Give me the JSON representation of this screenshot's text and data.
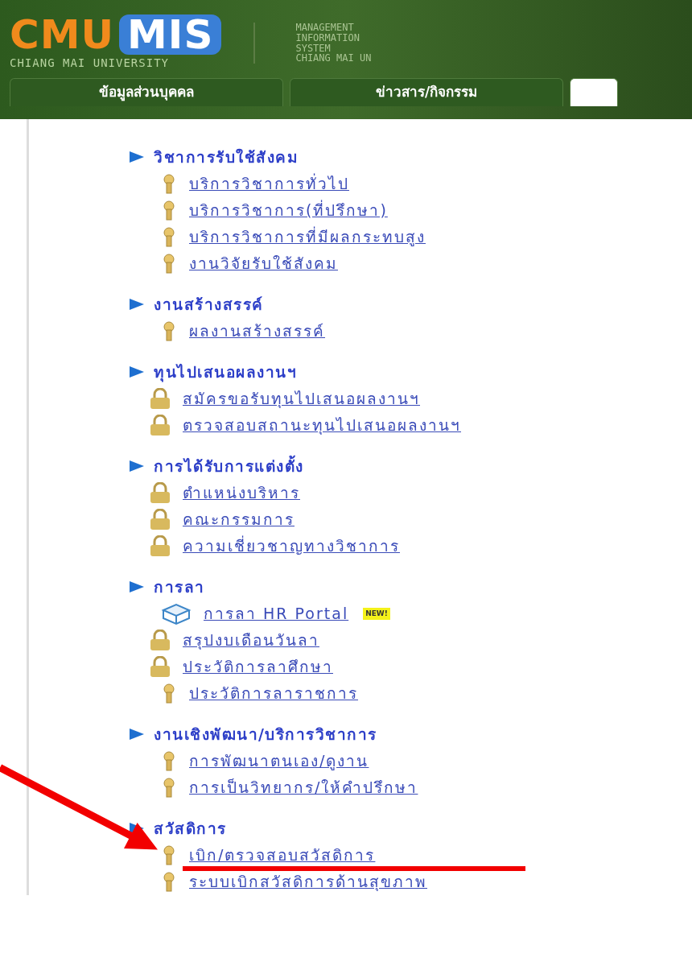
{
  "header": {
    "logo": {
      "primary": "CMU",
      "secondary": "MIS",
      "subtitle": "CHIANG MAI UNIVERSITY"
    },
    "tagline": [
      "MANAGEMENT",
      "INFORMATION",
      "SYSTEM",
      "CHIANG MAI UN"
    ]
  },
  "tabs": [
    {
      "label": "ข้อมูลส่วนบุคคล",
      "selected": false
    },
    {
      "label": "ข่าวสาร/กิจกรรม",
      "selected": false
    },
    {
      "selected": true
    }
  ],
  "menu": [
    {
      "title": "วิชาการรับใช้สังคม",
      "children": [
        {
          "label": "บริการวิชาการทั่วไป",
          "kind": "key"
        },
        {
          "label": "บริการวิชาการ(ที่ปรึกษา)",
          "kind": "key"
        },
        {
          "label": "บริการวิชาการที่มีผลกระทบสูง",
          "kind": "key"
        },
        {
          "label": "งานวิจัยรับใช้สังคม",
          "kind": "key"
        }
      ]
    },
    {
      "title": "งานสร้างสรรค์",
      "children": [
        {
          "label": "ผลงานสร้างสรรค์",
          "kind": "key"
        }
      ]
    },
    {
      "title": "ทุนไปเสนอผลงานฯ",
      "children": [
        {
          "label": "สมัครขอรับทุนไปเสนอผลงานฯ",
          "kind": "lock"
        },
        {
          "label": "ตรวจสอบสถานะทุนไปเสนอผลงานฯ",
          "kind": "lock"
        }
      ]
    },
    {
      "title": "การได้รับการแต่งตั้ง",
      "children": [
        {
          "label": "ตำแหน่งบริหาร",
          "kind": "lock"
        },
        {
          "label": "คณะกรรมการ",
          "kind": "lock"
        },
        {
          "label": "ความเชี่ยวชาญทางวิชาการ",
          "kind": "lock"
        }
      ]
    },
    {
      "title": "การลา",
      "children": [
        {
          "label": "การลา HR Portal",
          "kind": "portal",
          "badge": "NEW!"
        },
        {
          "label": "สรุปงบเดือนวันลา",
          "kind": "lock"
        },
        {
          "label": "ประวัติการลาศึกษา",
          "kind": "lock"
        },
        {
          "label": "ประวัติการลาราชการ",
          "kind": "key"
        }
      ]
    },
    {
      "title": "งานเชิงพัฒนา/บริการวิชาการ",
      "children": [
        {
          "label": "การพัฒนาตนเอง/ดูงาน",
          "kind": "key"
        },
        {
          "label": "การเป็นวิทยากร/ให้คำปรึกษา",
          "kind": "key"
        }
      ]
    },
    {
      "title": "สวัสดิการ",
      "children": [
        {
          "label": "เบิก/ตรวจสอบสวัสดิการ",
          "kind": "key"
        },
        {
          "label": "ระบบเบิกสวัสดิการด้านสุขภาพ",
          "kind": "key"
        }
      ]
    }
  ]
}
